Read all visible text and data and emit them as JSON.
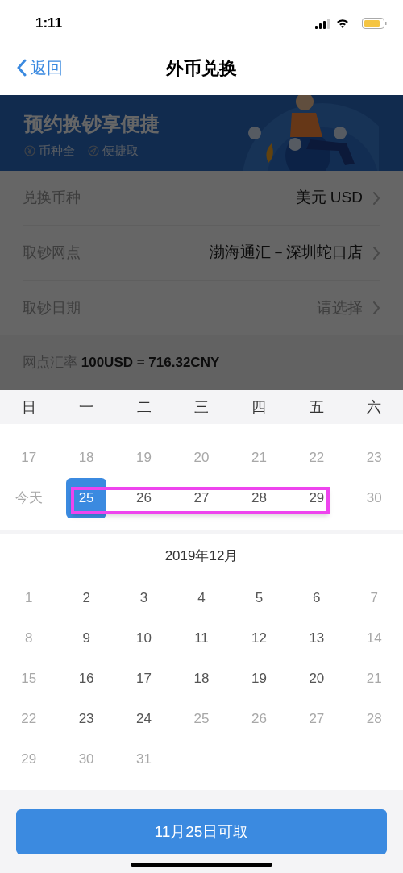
{
  "status_bar": {
    "time": "1:11"
  },
  "nav": {
    "back": "返回",
    "title": "外币兑换"
  },
  "banner": {
    "title": "预约换钞享便捷",
    "tags": [
      {
        "kind": "yen",
        "label": "币种全"
      },
      {
        "kind": "send",
        "label": "便捷取"
      }
    ]
  },
  "form": [
    {
      "label": "兑换币种",
      "value": "美元 USD",
      "placeholder": false
    },
    {
      "label": "取钞网点",
      "value": "渤海通汇－深圳蛇口店",
      "placeholder": false
    },
    {
      "label": "取钞日期",
      "value": "请选择",
      "placeholder": true
    }
  ],
  "rate": {
    "label": "网点汇率",
    "value": "100USD = 716.32CNY"
  },
  "weekdays": [
    "日",
    "一",
    "二",
    "三",
    "四",
    "五",
    "六"
  ],
  "november": {
    "weeks": [
      [
        {
          "day": "17",
          "enabled": false,
          "selected": false
        },
        {
          "day": "18",
          "enabled": false,
          "selected": false
        },
        {
          "day": "19",
          "enabled": false,
          "selected": false
        },
        {
          "day": "20",
          "enabled": false,
          "selected": false
        },
        {
          "day": "21",
          "enabled": false,
          "selected": false
        },
        {
          "day": "22",
          "enabled": false,
          "selected": false
        },
        {
          "day": "23",
          "enabled": false,
          "selected": false
        }
      ],
      [
        {
          "day": "今天",
          "enabled": false,
          "selected": false
        },
        {
          "day": "25",
          "enabled": true,
          "selected": true
        },
        {
          "day": "26",
          "enabled": true,
          "selected": false
        },
        {
          "day": "27",
          "enabled": true,
          "selected": false
        },
        {
          "day": "28",
          "enabled": true,
          "selected": false
        },
        {
          "day": "29",
          "enabled": true,
          "selected": false
        },
        {
          "day": "30",
          "enabled": false,
          "selected": false
        }
      ]
    ]
  },
  "december": {
    "title": "2019年12月",
    "weeks": [
      [
        {
          "day": "1",
          "enabled": false,
          "selected": false
        },
        {
          "day": "2",
          "enabled": true,
          "selected": false
        },
        {
          "day": "3",
          "enabled": true,
          "selected": false
        },
        {
          "day": "4",
          "enabled": true,
          "selected": false
        },
        {
          "day": "5",
          "enabled": true,
          "selected": false
        },
        {
          "day": "6",
          "enabled": true,
          "selected": false
        },
        {
          "day": "7",
          "enabled": false,
          "selected": false
        }
      ],
      [
        {
          "day": "8",
          "enabled": false,
          "selected": false
        },
        {
          "day": "9",
          "enabled": true,
          "selected": false
        },
        {
          "day": "10",
          "enabled": true,
          "selected": false
        },
        {
          "day": "11",
          "enabled": true,
          "selected": false
        },
        {
          "day": "12",
          "enabled": true,
          "selected": false
        },
        {
          "day": "13",
          "enabled": true,
          "selected": false
        },
        {
          "day": "14",
          "enabled": false,
          "selected": false
        }
      ],
      [
        {
          "day": "15",
          "enabled": false,
          "selected": false
        },
        {
          "day": "16",
          "enabled": true,
          "selected": false
        },
        {
          "day": "17",
          "enabled": true,
          "selected": false
        },
        {
          "day": "18",
          "enabled": true,
          "selected": false
        },
        {
          "day": "19",
          "enabled": true,
          "selected": false
        },
        {
          "day": "20",
          "enabled": true,
          "selected": false
        },
        {
          "day": "21",
          "enabled": false,
          "selected": false
        }
      ],
      [
        {
          "day": "22",
          "enabled": false,
          "selected": false
        },
        {
          "day": "23",
          "enabled": true,
          "selected": false
        },
        {
          "day": "24",
          "enabled": true,
          "selected": false
        },
        {
          "day": "25",
          "enabled": false,
          "selected": false
        },
        {
          "day": "26",
          "enabled": false,
          "selected": false
        },
        {
          "day": "27",
          "enabled": false,
          "selected": false
        },
        {
          "day": "28",
          "enabled": false,
          "selected": false
        }
      ],
      [
        {
          "day": "29",
          "enabled": false,
          "selected": false
        },
        {
          "day": "30",
          "enabled": false,
          "selected": false
        },
        {
          "day": "31",
          "enabled": false,
          "selected": false
        }
      ]
    ]
  },
  "confirm_button": "11月25日可取"
}
